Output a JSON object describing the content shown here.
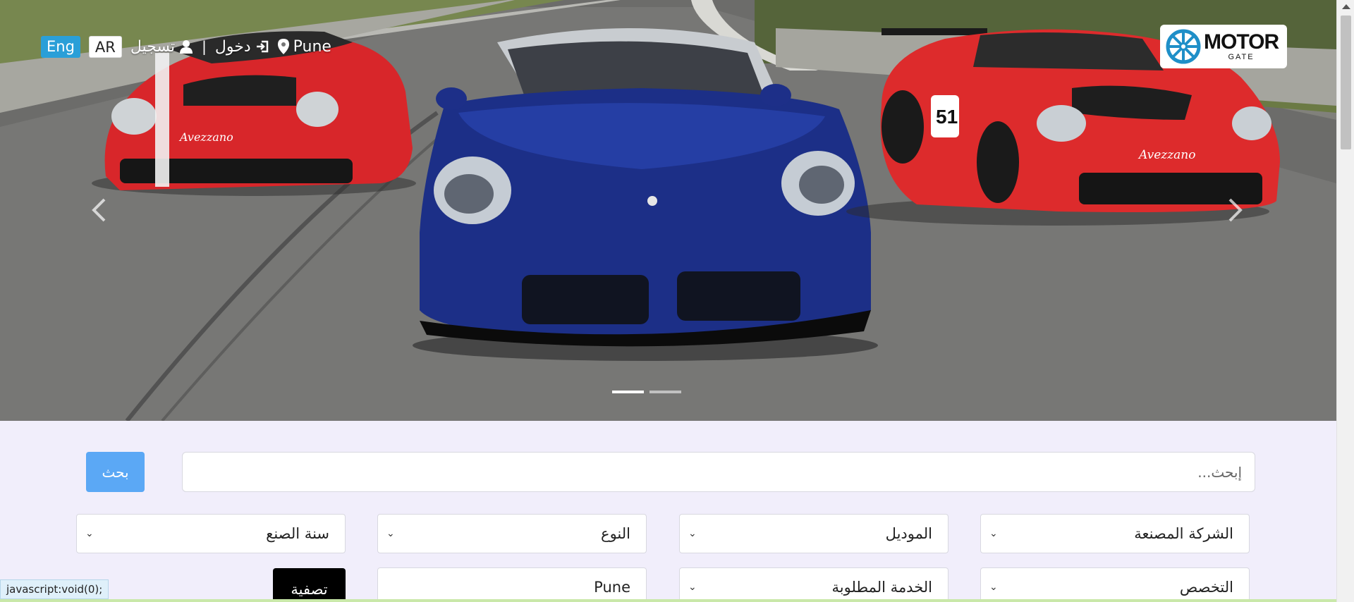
{
  "header": {
    "lang_eng": "Eng",
    "lang_ar": "AR",
    "register_label": "تسجيل",
    "login_label": "دخول",
    "location_label": "Pune",
    "separator": "|"
  },
  "logo": {
    "brand": "MOTOR",
    "sub": "GATE"
  },
  "carousel": {
    "slide_count": 2,
    "active_index": 0,
    "prev_icon": "chevron-left",
    "next_icon": "chevron-right"
  },
  "search": {
    "placeholder": "إبحث...",
    "button_label": "بحث"
  },
  "filters": {
    "manufacturer": "الشركة المصنعة",
    "model": "الموديل",
    "type": "النوع",
    "year": "سنة الصنع",
    "specialty": "التخصص",
    "service": "الخدمة المطلوبة",
    "location": "Pune",
    "filter_button": "تصفية"
  },
  "status_bar": {
    "text": "javascript:void(0);"
  },
  "colors": {
    "accent": "#2a9fd8",
    "search_button": "#5ba8f5",
    "background": "#f1eefb"
  }
}
